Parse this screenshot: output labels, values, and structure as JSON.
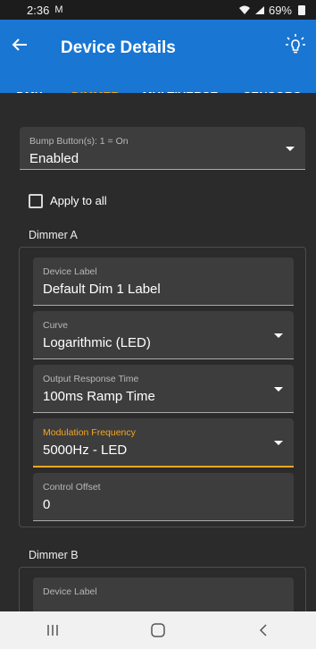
{
  "status_bar": {
    "time": "2:36",
    "message_glyph": "M",
    "battery": "69%"
  },
  "app_bar": {
    "title": "Device Details"
  },
  "tabs": [
    {
      "label": "DMX",
      "active": false
    },
    {
      "label": "DIMMER",
      "active": true
    },
    {
      "label": "MULTIVERSE",
      "active": false
    },
    {
      "label": "SENSORS",
      "active": false
    }
  ],
  "bump": {
    "label": "Bump Button(s): 1 = On",
    "value": "Enabled"
  },
  "apply_all": {
    "label": "Apply to all",
    "checked": false
  },
  "dimmer_a": {
    "title": "Dimmer A",
    "device_label": {
      "label": "Device Label",
      "value": "Default Dim 1 Label"
    },
    "curve": {
      "label": "Curve",
      "value": "Logarithmic (LED)"
    },
    "response": {
      "label": "Output Response Time",
      "value": "100ms Ramp Time"
    },
    "modulation": {
      "label": "Modulation Frequency",
      "value": "5000Hz - LED"
    },
    "offset": {
      "label": "Control Offset",
      "value": "0"
    }
  },
  "dimmer_b": {
    "title": "Dimmer B",
    "device_label": {
      "label": "Device Label"
    }
  },
  "colors": {
    "primary": "#1976d2",
    "accent": "#f5a623",
    "background": "#2b2b2b",
    "field": "#3d3d3d"
  }
}
